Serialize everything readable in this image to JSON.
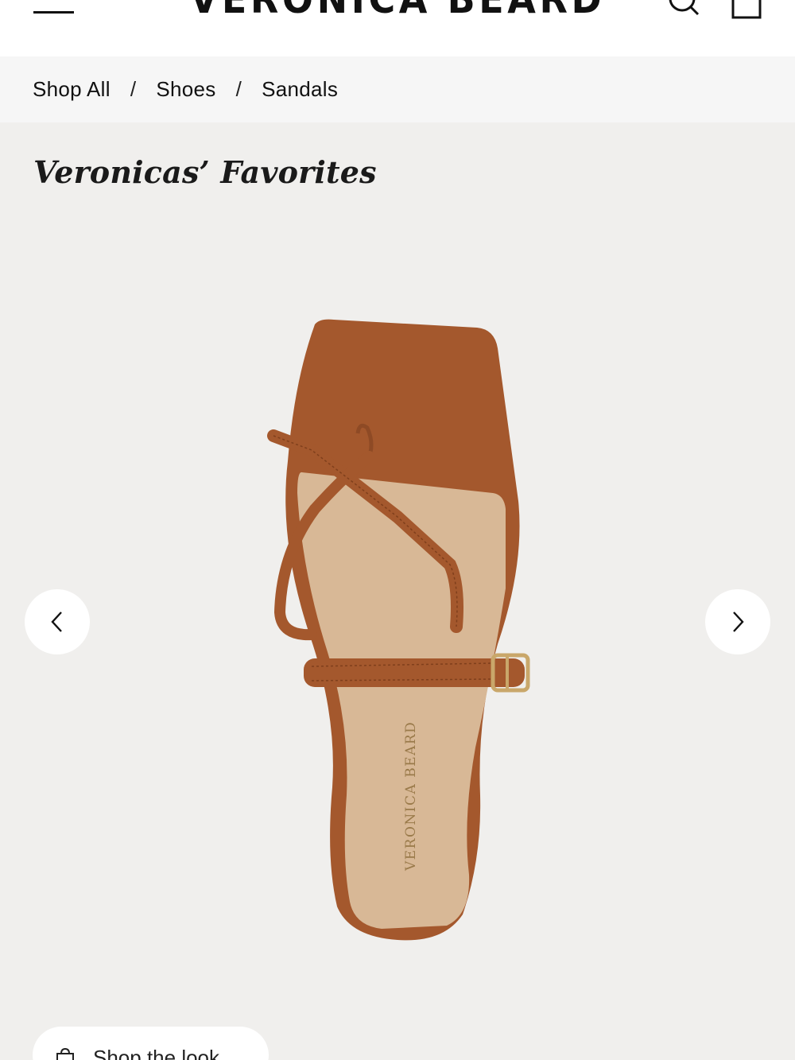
{
  "header": {
    "logo": "VERONICA BEARD",
    "icons": {
      "menu": "hamburger-menu-icon",
      "search": "search-icon",
      "cart": "shopping-bag-icon"
    }
  },
  "breadcrumb": {
    "items": [
      "Shop All",
      "Shoes",
      "Sandals"
    ],
    "separator": "/"
  },
  "section": {
    "title": "Veronicas’ Favorites"
  },
  "product": {
    "insole_brand": "VERONICA BEARD",
    "colors": {
      "leather": "#a4582d",
      "insole": "#d8b896",
      "buckle": "#c9a76a"
    }
  },
  "carousel": {
    "prev_icon": "chevron-left-icon",
    "next_icon": "chevron-right-icon"
  },
  "shop_the_look": {
    "label": "Shop the look",
    "icon": "shopping-bag-icon"
  },
  "colors": {
    "background": "#f0efed",
    "header": "#ffffff",
    "breadcrumb_bg": "#f6f6f6"
  }
}
